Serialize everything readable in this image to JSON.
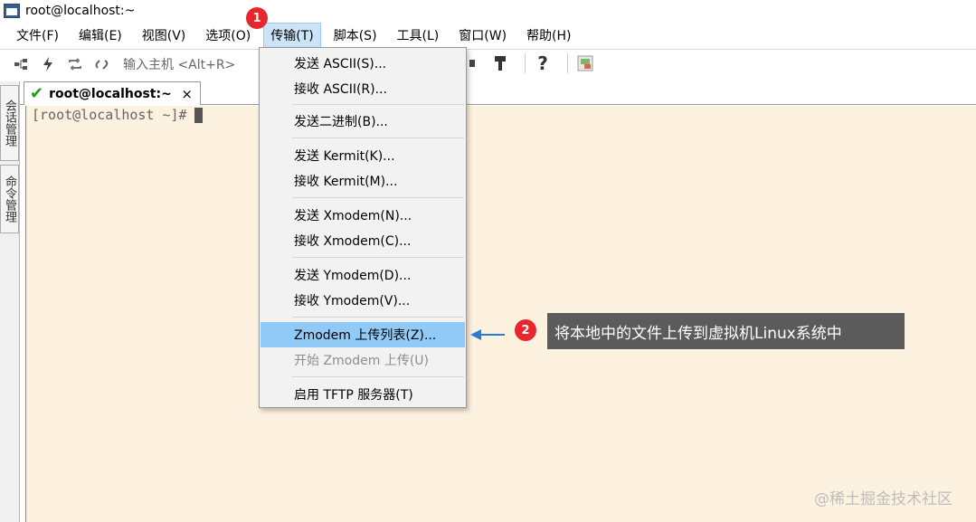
{
  "window": {
    "title": "root@localhost:~"
  },
  "menubar": {
    "file": "文件(F)",
    "edit": "编辑(E)",
    "view": "视图(V)",
    "options": "选项(O)",
    "transfer": "传输(T)",
    "script": "脚本(S)",
    "tools": "工具(L)",
    "window": "窗口(W)",
    "help": "帮助(H)"
  },
  "toolbar": {
    "host_placeholder": "输入主机 <Alt+R>"
  },
  "sidebar": {
    "session_manager": "会话管理",
    "command_manager": "命令管理"
  },
  "session_tab": {
    "label": "root@localhost:~",
    "close": "×"
  },
  "terminal": {
    "prompt": "[root@localhost ~]#"
  },
  "transfer_menu": {
    "items": [
      {
        "label": "发送 ASCII(S)..."
      },
      {
        "label": "接收 ASCII(R)..."
      },
      {
        "label": "发送二进制(B)..."
      },
      {
        "label": "发送 Kermit(K)..."
      },
      {
        "label": "接收 Kermit(M)..."
      },
      {
        "label": "发送 Xmodem(N)..."
      },
      {
        "label": "接收 Xmodem(C)..."
      },
      {
        "label": "发送 Ymodem(D)..."
      },
      {
        "label": "接收 Ymodem(V)..."
      },
      {
        "label": "Zmodem 上传列表(Z)..."
      },
      {
        "label": "开始 Zmodem 上传(U)"
      },
      {
        "label": "启用 TFTP 服务器(T)"
      }
    ],
    "highlight_color": "#91c9f7"
  },
  "annotations": {
    "step1": "1",
    "step2": "2",
    "callout": "将本地中的文件上传到虚拟机Linux系统中",
    "badge_color": "#e8262d",
    "arrow_color": "#2b7bd0"
  },
  "watermark": "@稀土掘金技术社区"
}
